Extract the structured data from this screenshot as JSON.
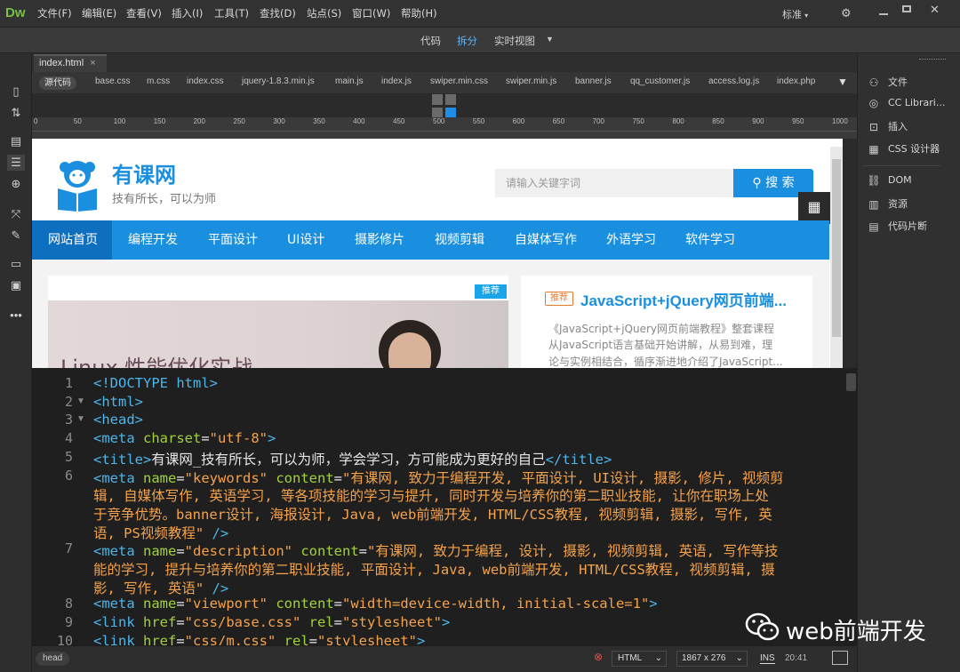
{
  "app": {
    "logo": "Dw",
    "mode": "标准"
  },
  "menu": [
    "文件(F)",
    "编辑(E)",
    "查看(V)",
    "插入(I)",
    "工具(T)",
    "查找(D)",
    "站点(S)",
    "窗口(W)",
    "帮助(H)"
  ],
  "views": {
    "code": "代码",
    "split": "拆分",
    "live": "实时视图"
  },
  "doc": {
    "tab": "index.html",
    "source": "源代码",
    "related": [
      "base.css",
      "m.css",
      "index.css",
      "jquery-1.8.3.min.js",
      "main.js",
      "index.js",
      "swiper.min.css",
      "swiper.min.js",
      "banner.js",
      "qq_customer.js",
      "access.log.js",
      "index.php"
    ]
  },
  "ruler": [
    "0",
    "50",
    "100",
    "150",
    "200",
    "250",
    "300",
    "350",
    "400",
    "450",
    "500",
    "550",
    "600",
    "650",
    "700",
    "750",
    "800",
    "850",
    "900",
    "950",
    "1000"
  ],
  "site": {
    "name": "有课网",
    "slogan": "技有所长，可以为师",
    "search_placeholder": "请输入关键字词",
    "search_btn": "搜 索",
    "nav": [
      "网站首页",
      "编程开发",
      "平面设计",
      "UI设计",
      "摄影修片",
      "视频剪辑",
      "自媒体写作",
      "外语学习",
      "软件学习"
    ],
    "badge": "推荐",
    "banner_text": "Linux 性能优化实战",
    "tag": "推荐",
    "course_title": "JavaScript+jQuery网页前端...",
    "course_desc": [
      "《JavaScript+jQuery网页前端教程》整套课程",
      "从JavaScript语言基础开始讲解，从易到难，理",
      "论与实例相结合，循序渐进地介绍了JavaScript..."
    ]
  },
  "code": {
    "line_numbers": [
      "1",
      "2",
      "3",
      "4",
      "5",
      "6",
      "7",
      "8",
      "9",
      "10"
    ],
    "lines": [
      [
        [
          "tg",
          "<!DOCTYPE html>"
        ]
      ],
      [
        [
          "tg",
          "<html>"
        ]
      ],
      [
        [
          "tg",
          "<head>"
        ]
      ],
      [
        [
          "tg",
          "<meta "
        ],
        [
          "at",
          "charset"
        ],
        [
          "tx",
          "="
        ],
        [
          "vl",
          "\"utf-8\""
        ],
        [
          "tg",
          ">"
        ]
      ],
      [
        [
          "tg",
          "<title>"
        ],
        [
          "tx",
          "有课网_技有所长，可以为师，学会学习，方可能成为更好的自己"
        ],
        [
          "tg",
          "</title>"
        ]
      ],
      [
        [
          "tg",
          "<meta "
        ],
        [
          "at",
          "name"
        ],
        [
          "tx",
          "="
        ],
        [
          "vl",
          "\"keywords\" "
        ],
        [
          "at",
          "content"
        ],
        [
          "tx",
          "="
        ],
        [
          "vl",
          "\"有课网, 致力于编程开发, 平面设计, UI设计, 摄影, 修片, 视频剪"
        ]
      ],
      [
        [
          "vl",
          "辑, 自媒体写作, 英语学习, 等各项技能的学习与提升, 同时开发与培养你的第二职业技能, 让你在职场上处"
        ]
      ],
      [
        [
          "vl",
          "于竞争优势。banner设计, 海报设计, Java, web前端开发, HTML/CSS教程, 视频剪辑, 摄影, 写作, 英"
        ]
      ],
      [
        [
          "vl",
          "语, PS视频教程\" "
        ],
        [
          "tg",
          "/>"
        ]
      ],
      [
        [
          "tg",
          "<meta "
        ],
        [
          "at",
          "name"
        ],
        [
          "tx",
          "="
        ],
        [
          "vl",
          "\"description\" "
        ],
        [
          "at",
          "content"
        ],
        [
          "tx",
          "="
        ],
        [
          "vl",
          "\"有课网, 致力于编程, 设计, 摄影, 视频剪辑, 英语, 写作等技"
        ]
      ],
      [
        [
          "vl",
          "能的学习, 提升与培养你的第二职业技能, 平面设计, Java, web前端开发, HTML/CSS教程, 视频剪辑, 摄"
        ]
      ],
      [
        [
          "vl",
          "影, 写作, 英语\" "
        ],
        [
          "tg",
          "/>"
        ]
      ],
      [
        [
          "tg",
          "<meta "
        ],
        [
          "at",
          "name"
        ],
        [
          "tx",
          "="
        ],
        [
          "vl",
          "\"viewport\" "
        ],
        [
          "at",
          "content"
        ],
        [
          "tx",
          "="
        ],
        [
          "vl",
          "\"width=device-width, initial-scale=1\""
        ],
        [
          "tg",
          ">"
        ]
      ],
      [
        [
          "tg",
          "<link "
        ],
        [
          "at",
          "href"
        ],
        [
          "tx",
          "="
        ],
        [
          "vl",
          "\"css/base.css\" "
        ],
        [
          "at",
          "rel"
        ],
        [
          "tx",
          "="
        ],
        [
          "vl",
          "\"stylesheet\""
        ],
        [
          "tg",
          ">"
        ]
      ],
      [
        [
          "tg",
          "<link "
        ],
        [
          "at",
          "href"
        ],
        [
          "tx",
          "="
        ],
        [
          "vl",
          "\"css/m.css\" "
        ],
        [
          "at",
          "rel"
        ],
        [
          "tx",
          "="
        ],
        [
          "vl",
          "\"stylesheet\""
        ],
        [
          "tg",
          ">"
        ]
      ]
    ]
  },
  "status": {
    "tag": "head",
    "lang": "HTML",
    "size": "1867 x 276",
    "ins": "INS",
    "pos": "20:41"
  },
  "panels": [
    "文件",
    "CC Librari...",
    "插入",
    "CSS 设计器",
    "DOM",
    "资源",
    "代码片断"
  ],
  "watermark": "web前端开发"
}
